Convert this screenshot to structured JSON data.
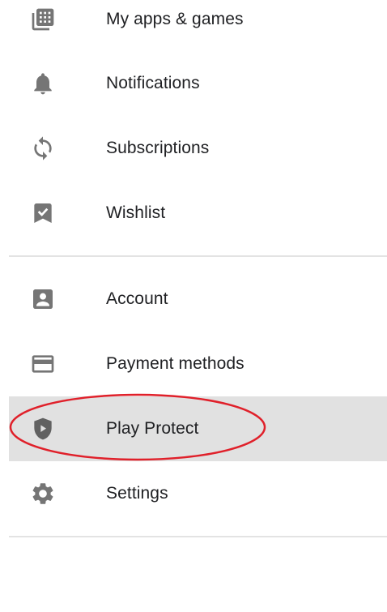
{
  "menu": {
    "items": [
      {
        "label": "My apps & games",
        "icon": "apps-icon"
      },
      {
        "label": "Notifications",
        "icon": "bell-icon"
      },
      {
        "label": "Subscriptions",
        "icon": "refresh-icon"
      },
      {
        "label": "Wishlist",
        "icon": "bookmark-check-icon"
      },
      {
        "label": "Account",
        "icon": "account-box-icon"
      },
      {
        "label": "Payment methods",
        "icon": "credit-card-icon"
      },
      {
        "label": "Play Protect",
        "icon": "shield-play-icon"
      },
      {
        "label": "Settings",
        "icon": "gear-icon"
      }
    ],
    "selected": "Play Protect"
  },
  "colors": {
    "icon": "#757575",
    "text": "#202124",
    "selected_bg": "#e1e1e1",
    "highlight_ring": "#e0202a",
    "divider": "#e3e3e3"
  }
}
